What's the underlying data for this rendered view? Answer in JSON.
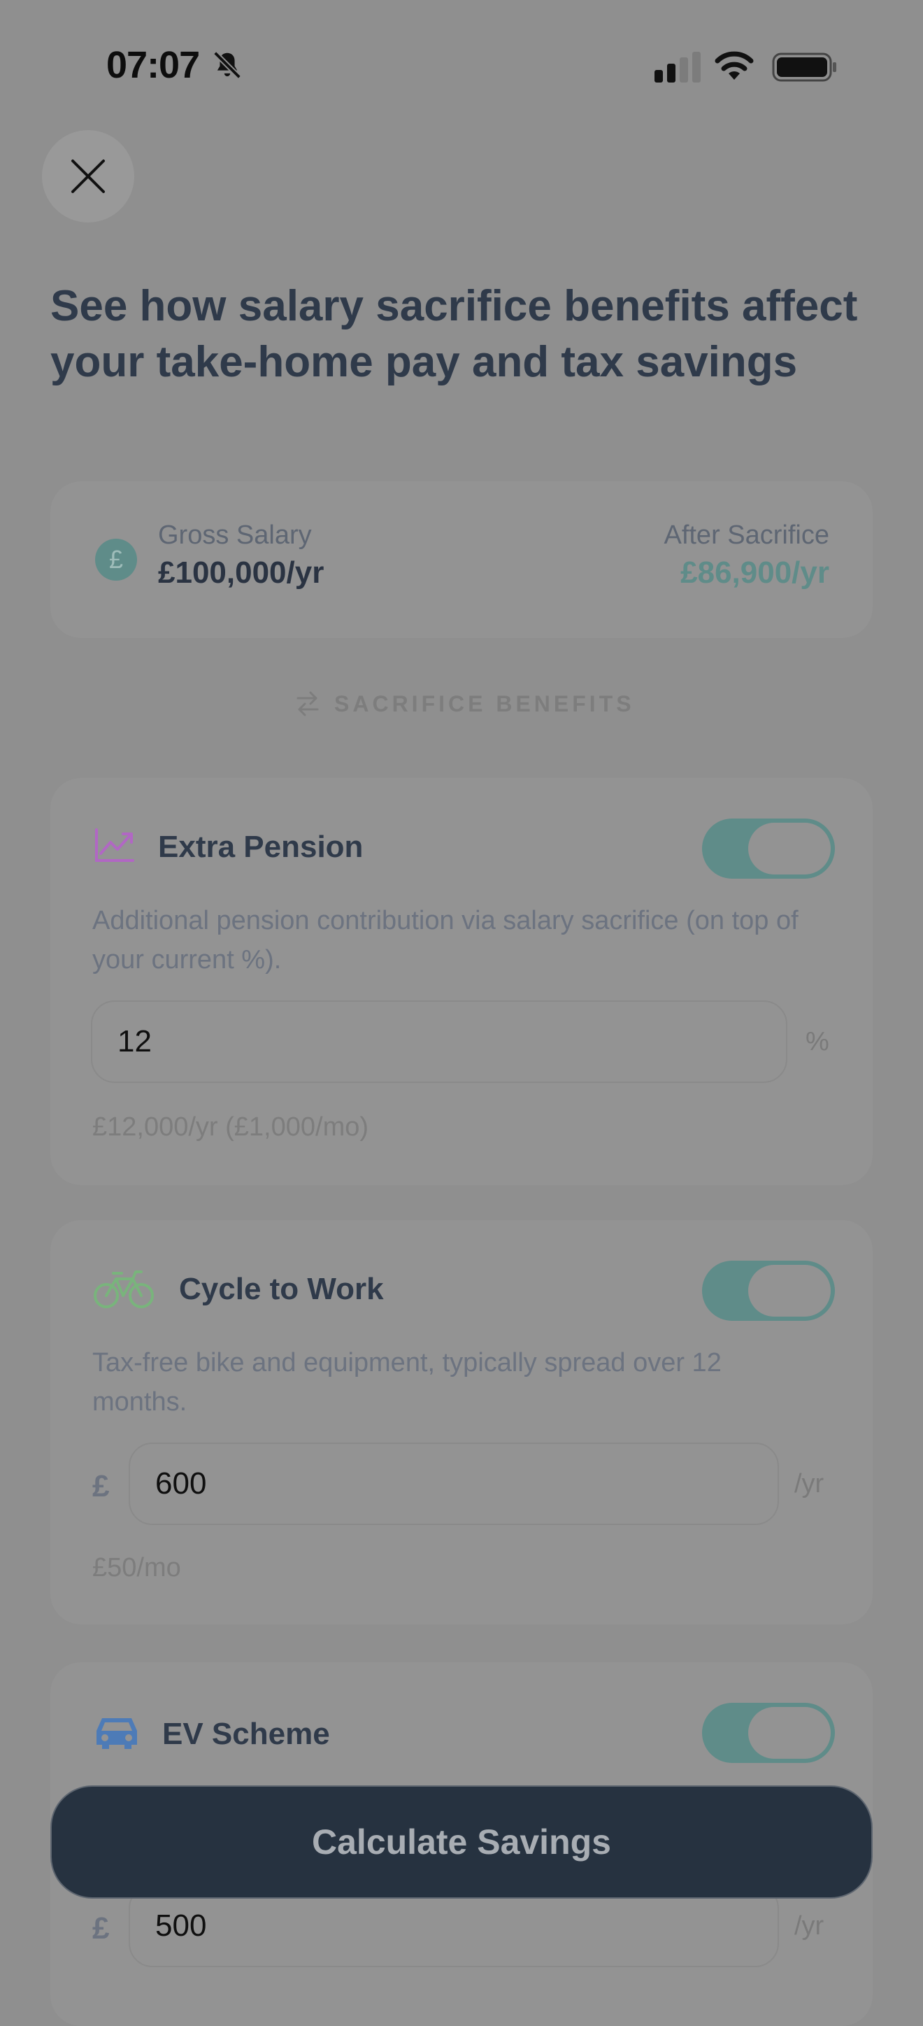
{
  "status_bar": {
    "time": "07:07"
  },
  "header": {
    "title": "See how salary sacrifice benefits affect your take-home pay and tax savings"
  },
  "salary_summary": {
    "gross_label": "Gross Salary",
    "gross_value": "£100,000/yr",
    "after_label": "After Sacrifice",
    "after_value": "£86,900/yr",
    "currency_symbol": "£"
  },
  "section": {
    "label": "SACRIFICE BENEFITS"
  },
  "benefits": {
    "pension": {
      "title": "Extra Pension",
      "enabled": true,
      "description": "Additional pension contribution via salary sacrifice (on top of your current %).",
      "value": "12",
      "unit": "%",
      "note": "£12,000/yr (£1,000/mo)"
    },
    "cycle": {
      "title": "Cycle to Work",
      "enabled": true,
      "description": "Tax-free bike and equipment, typically spread over 12 months.",
      "prefix": "£",
      "value": "600",
      "unit": "/yr",
      "note": "£50/mo"
    },
    "ev": {
      "title": "EV Scheme",
      "enabled": true,
      "prefix": "£",
      "value": "500",
      "unit": "/yr"
    }
  },
  "cta": {
    "label": "Calculate Savings"
  },
  "colors": {
    "accent": "#5f8c89",
    "pension_icon": "#b167c4",
    "cycle_icon": "#79b47c",
    "ev_icon": "#4d7bb7",
    "cta_bg": "#263240"
  },
  "icons": {
    "close": "close-icon",
    "pension": "trending-up-icon",
    "cycle": "bicycle-icon",
    "ev": "car-icon",
    "section": "swap-arrows-icon"
  }
}
